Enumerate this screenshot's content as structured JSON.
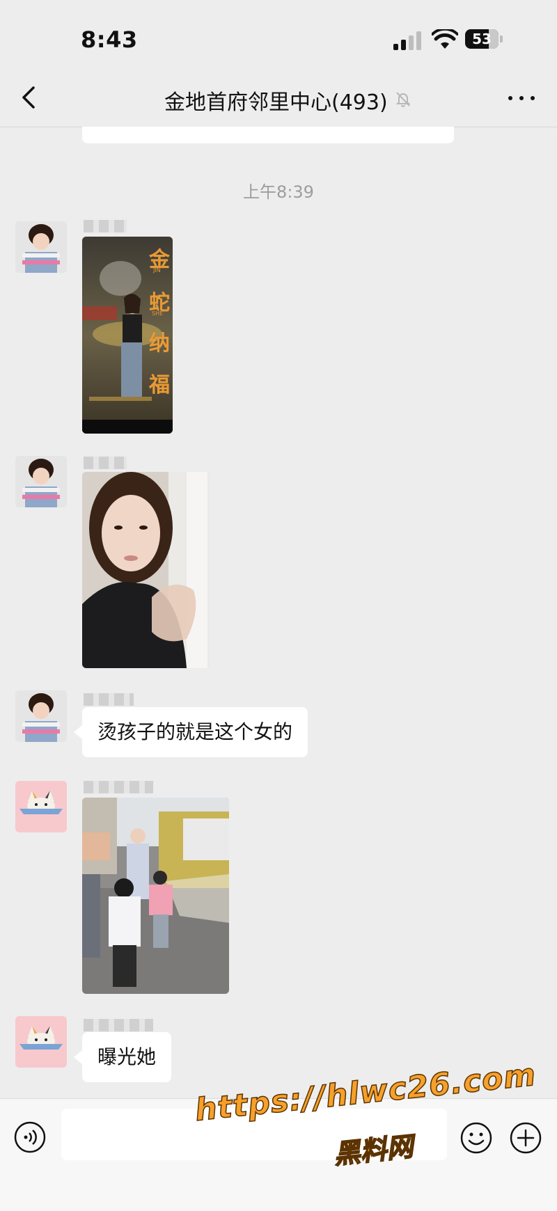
{
  "status_bar": {
    "time": "8:43",
    "battery": "53"
  },
  "header": {
    "title": "金地首府邻里中心(493)"
  },
  "timestamp": "上午8:39",
  "messages": {
    "m3_text": "烫孩子的就是这个女的",
    "m5_text": "曝光她"
  },
  "image_texts": {
    "poster_char_1": "金",
    "poster_char_2": "蛇",
    "poster_char_3": "纳",
    "poster_char_4": "福",
    "poster_pinyin_1": "JIN",
    "poster_pinyin_2": "SHE"
  },
  "watermark": {
    "url": "https://hlwc26.com",
    "name": "黑料网"
  },
  "colors": {
    "background": "#ededed",
    "bubble": "#ffffff",
    "watermark": "#f6a02b"
  }
}
